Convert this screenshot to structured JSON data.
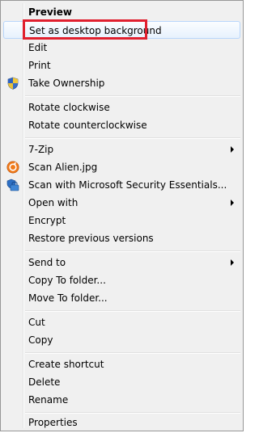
{
  "menu": {
    "items": [
      {
        "label": "Preview"
      },
      {
        "label": "Set as desktop background"
      },
      {
        "label": "Edit"
      },
      {
        "label": "Print"
      },
      {
        "label": "Take Ownership",
        "icon": "uac-shield-icon"
      },
      {
        "label": "Rotate clockwise"
      },
      {
        "label": "Rotate counterclockwise"
      },
      {
        "label": "7-Zip"
      },
      {
        "label": "Scan Alien.jpg",
        "icon": "avast-scan-icon"
      },
      {
        "label": "Scan with Microsoft Security Essentials...",
        "icon": "mse-icon"
      },
      {
        "label": "Open with"
      },
      {
        "label": "Encrypt"
      },
      {
        "label": "Restore previous versions"
      },
      {
        "label": "Send to"
      },
      {
        "label": "Copy To folder..."
      },
      {
        "label": "Move To folder..."
      },
      {
        "label": "Cut"
      },
      {
        "label": "Copy"
      },
      {
        "label": "Create shortcut"
      },
      {
        "label": "Delete"
      },
      {
        "label": "Rename"
      },
      {
        "label": "Properties"
      }
    ]
  },
  "colors": {
    "highlight_border": "#e0202f",
    "menu_background": "#f0f0f0"
  }
}
